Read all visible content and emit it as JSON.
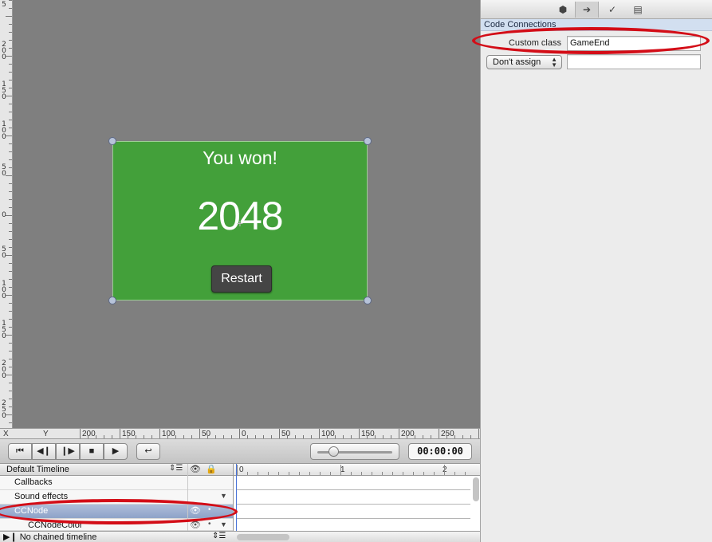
{
  "ruler_left": {
    "labels": [
      "5",
      "2 0 0",
      "1 5 0",
      "1 0 0",
      "5 0",
      "0",
      "5 0",
      "1 0 0",
      "1 5 0",
      "2 0 0",
      "2 5 0"
    ]
  },
  "ruler_bottom": {
    "labels": [
      "X",
      "Y",
      "200",
      "150",
      "100",
      "50",
      "0",
      "50",
      "100",
      "150",
      "200",
      "250"
    ]
  },
  "scene": {
    "title": "You won!",
    "score": "2048",
    "restart_label": "Restart",
    "background_color": "#43a03a"
  },
  "playback": {
    "buttons": [
      "first-frame",
      "step-back",
      "step-forward",
      "stop",
      "play",
      "loop"
    ],
    "timecode": "00:00:00"
  },
  "timeline": {
    "name": "Default Timeline",
    "ruler_marks": [
      "0",
      "1",
      "2"
    ],
    "rows": [
      {
        "label": "Callbacks"
      },
      {
        "label": "Sound effects"
      },
      {
        "label": "CCNode"
      },
      {
        "label": "CCNodeColor"
      }
    ],
    "chained_timeline": "No chained timeline"
  },
  "inspector": {
    "section_title": "Code Connections",
    "custom_class_label": "Custom class",
    "custom_class_value": "GameEnd",
    "assign_option": "Don't assign",
    "assign_value": ""
  }
}
